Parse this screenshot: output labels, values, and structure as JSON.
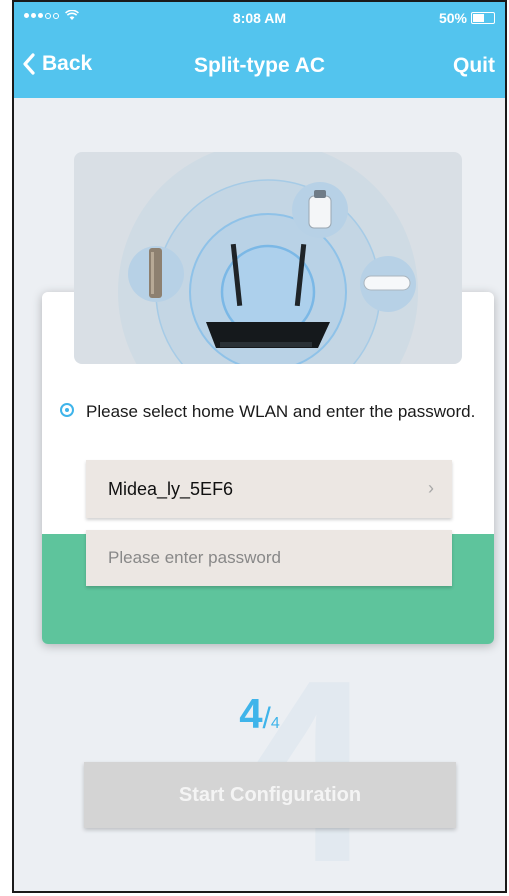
{
  "status": {
    "time": "8:08 AM",
    "battery": "50%"
  },
  "nav": {
    "back_label": "Back",
    "title": "Split-type AC",
    "quit_label": "Quit"
  },
  "instruction": "Please select home WLAN and enter the password.",
  "wlan": {
    "selected": "Midea_ly_5EF6"
  },
  "password": {
    "placeholder": "Please enter password",
    "value": ""
  },
  "step": {
    "current": "4",
    "separator": "/",
    "total": "4"
  },
  "start_button_label": "Start Configuration",
  "colors": {
    "header": "#53c4ee",
    "accent": "#3fb4ea",
    "card_green": "#5ec49c",
    "button_disabled": "#d4d4d4"
  },
  "icons": [
    "signal-dots-icon",
    "wifi-icon",
    "battery-icon",
    "back-chevron-icon",
    "radio-selected-icon",
    "chevron-right-icon",
    "router-icon",
    "tower-speaker-icon",
    "cylinder-device-icon",
    "split-ac-icon"
  ]
}
